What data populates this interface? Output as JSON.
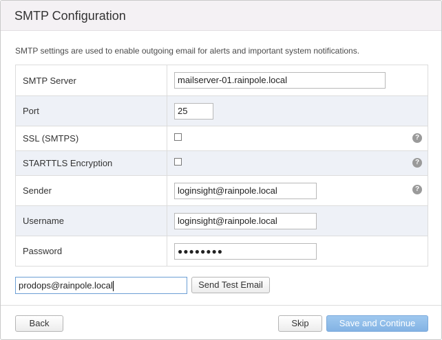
{
  "dialog": {
    "title": "SMTP Configuration",
    "description": "SMTP settings are used to enable outgoing email for alerts and important system notifications."
  },
  "fields": {
    "smtp_server": {
      "label": "SMTP Server",
      "value": "mailserver-01.rainpole.local"
    },
    "port": {
      "label": "Port",
      "value": "25"
    },
    "ssl": {
      "label": "SSL (SMTPS)",
      "checked": false,
      "help_icon": "question-icon"
    },
    "starttls": {
      "label": "STARTTLS Encryption",
      "checked": false,
      "help_icon": "question-icon"
    },
    "sender": {
      "label": "Sender",
      "value": "loginsight@rainpole.local",
      "help_icon": "question-icon"
    },
    "username": {
      "label": "Username",
      "value": "loginsight@rainpole.local"
    },
    "password": {
      "label": "Password",
      "value": "●●●●●●●●"
    }
  },
  "test_email": {
    "value": "prodops@rainpole.local",
    "send_label": "Send Test Email"
  },
  "footer": {
    "back_label": "Back",
    "skip_label": "Skip",
    "save_label": "Save and Continue"
  },
  "help_glyph": "?",
  "colors": {
    "header_bg": "#f4f1f4",
    "alt_row_bg": "#eef1f7",
    "primary_button": "#8dbbe9",
    "focus_border": "#6b9ed4"
  }
}
